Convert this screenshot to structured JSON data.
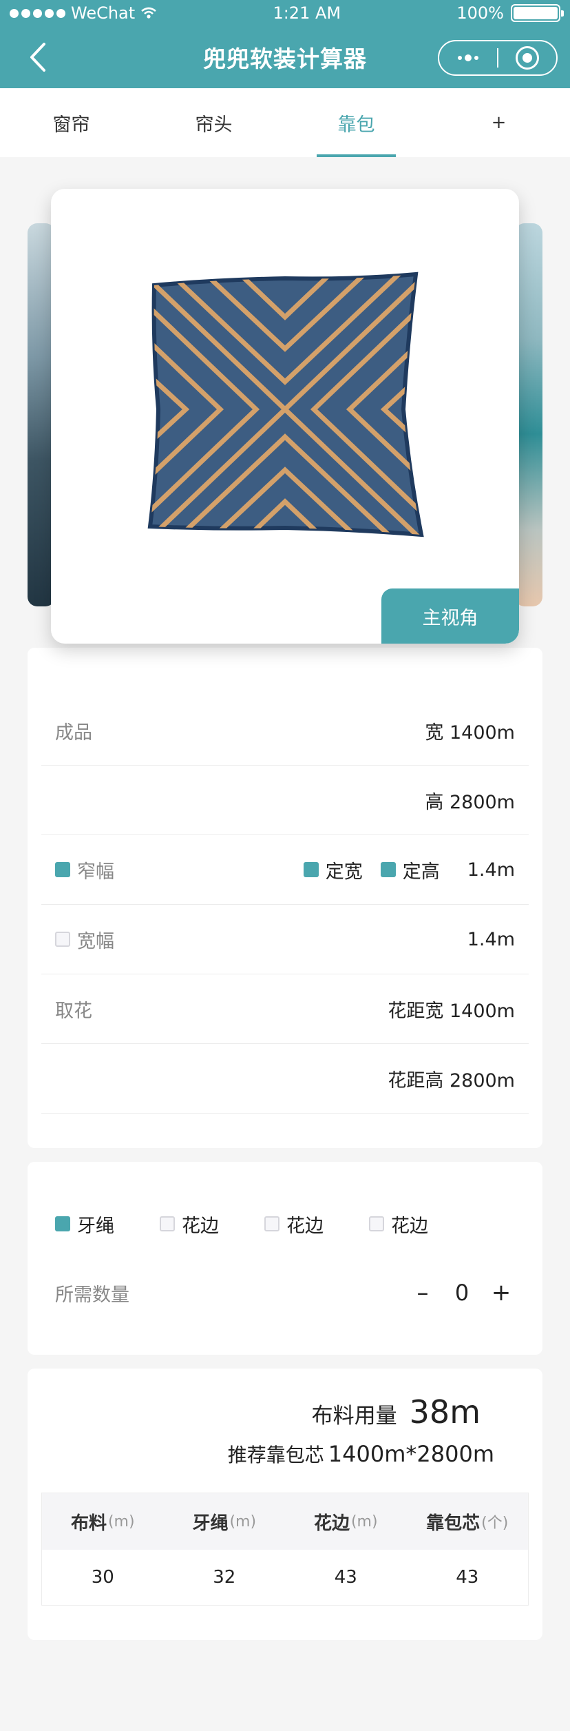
{
  "status_bar": {
    "carrier": "WeChat",
    "time": "1:21 AM",
    "battery": "100%",
    "battery_level": 1.0
  },
  "nav": {
    "title": "兜兜软装计算器"
  },
  "tabs": [
    {
      "label": "窗帘"
    },
    {
      "label": "帘头"
    },
    {
      "label": "靠包"
    },
    {
      "label": "+"
    }
  ],
  "active_tab": 2,
  "carousel": {
    "view_button": "主视角"
  },
  "colors": {
    "accent": "#4aa6ae",
    "pillow_fabric": "#3d5d82",
    "pillow_stripe": "#d4a16a"
  },
  "form": {
    "finished": {
      "label": "成品",
      "width": "宽 1400m",
      "height": "高 2800m"
    },
    "narrow": {
      "label": "窄幅",
      "checked": true,
      "fixed_width": "定宽",
      "fixed_width_checked": true,
      "fixed_height": "定高",
      "fixed_height_checked": true,
      "value": "1.4m"
    },
    "wide": {
      "label": "宽幅",
      "checked": false,
      "value": "1.4m"
    },
    "pattern": {
      "label": "取花",
      "repeat_width": "花距宽 1400m",
      "repeat_height": "花距高 2800m"
    }
  },
  "options": {
    "items": [
      {
        "label": "牙绳",
        "checked": true
      },
      {
        "label": "花边",
        "checked": false
      },
      {
        "label": "花边",
        "checked": false
      },
      {
        "label": "花边",
        "checked": false
      }
    ],
    "quantity_label": "所需数量",
    "minus": "–",
    "quantity": "0",
    "plus": "+"
  },
  "result": {
    "usage_label": "布料用量",
    "usage_value": "38m",
    "recommend_label": "推荐靠包芯",
    "recommend_value": "1400m*2800m",
    "columns": [
      {
        "name": "布料",
        "unit": "(m)"
      },
      {
        "name": "牙绳",
        "unit": "(m)"
      },
      {
        "name": "花边",
        "unit": "(m)"
      },
      {
        "name": "靠包芯",
        "unit": "(个)"
      }
    ],
    "values": [
      "30",
      "32",
      "43",
      "43"
    ]
  }
}
